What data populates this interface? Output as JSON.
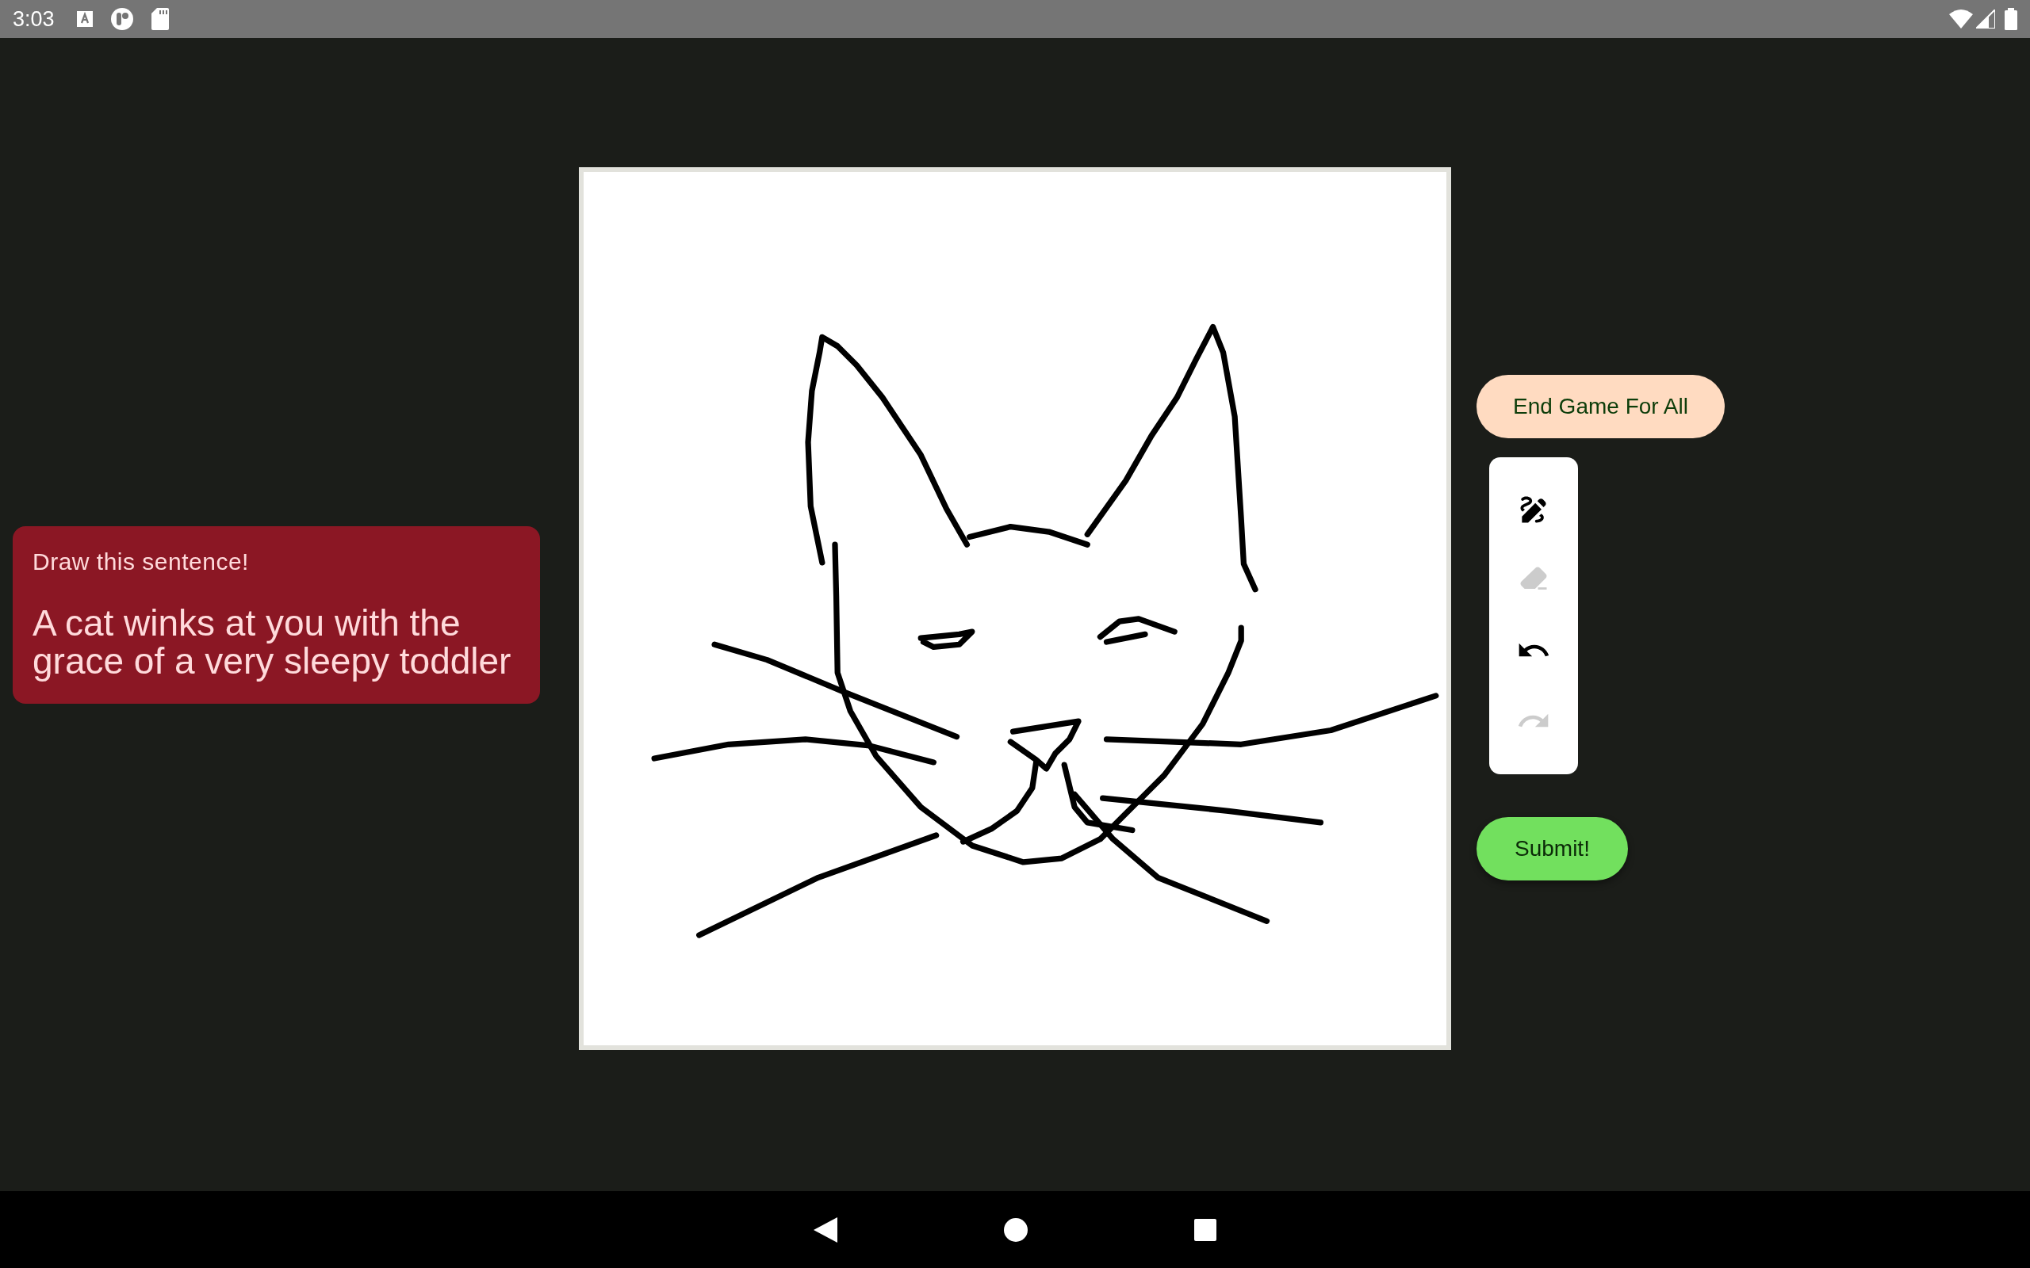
{
  "status_bar": {
    "time": "3:03"
  },
  "prompt_card": {
    "heading": "Draw this sentence!",
    "sentence": "A cat winks at you with the grace of a very sleepy toddler"
  },
  "actions": {
    "end_game": "End Game For All",
    "submit": "Submit!"
  },
  "toolbar": [
    {
      "kind": "pen",
      "disabled": false
    },
    {
      "kind": "eraser",
      "disabled": true
    },
    {
      "kind": "undo",
      "disabled": false
    },
    {
      "kind": "redo",
      "disabled": true
    }
  ]
}
